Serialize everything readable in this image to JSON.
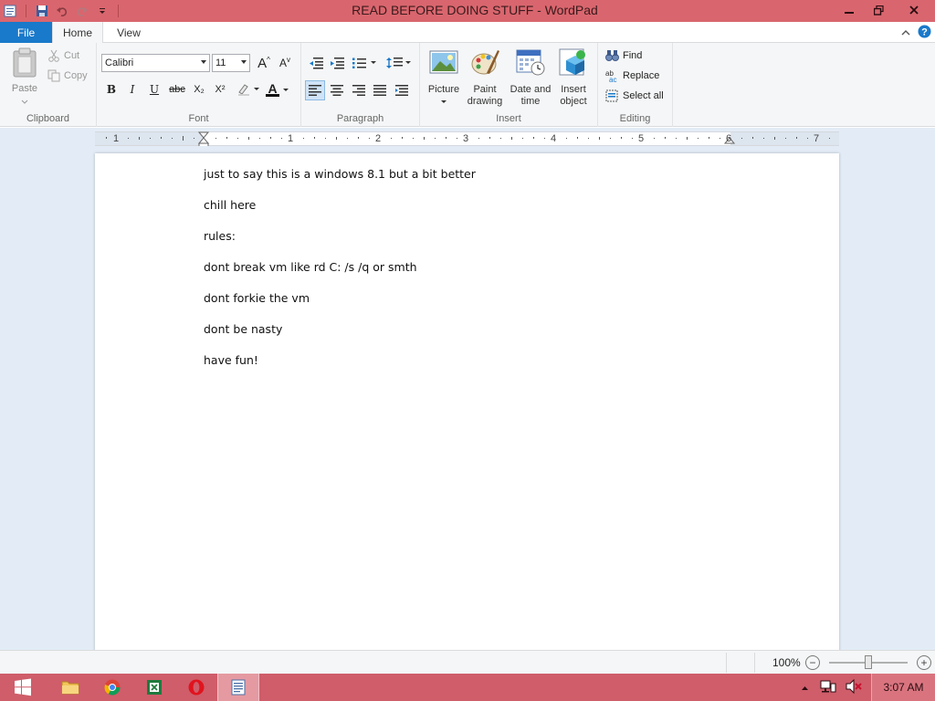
{
  "window": {
    "title": "READ BEFORE DOING STUFF - WordPad",
    "minimize_icon": "minimize-icon",
    "maximize_icon": "restore-icon",
    "close_icon": "close-icon"
  },
  "tabs": {
    "file": "File",
    "home": "Home",
    "view": "View"
  },
  "ribbon": {
    "clipboard": {
      "label": "Clipboard",
      "paste": "Paste",
      "cut": "Cut",
      "copy": "Copy"
    },
    "font": {
      "label": "Font",
      "family": "Calibri",
      "size": "11",
      "bold": "B",
      "italic": "I",
      "underline": "U",
      "strike": "abc",
      "subscript": "X₂",
      "superscript": "X²",
      "grow": "A",
      "shrink": "A",
      "text_color_glyph": "A"
    },
    "paragraph": {
      "label": "Paragraph"
    },
    "insert": {
      "label": "Insert",
      "picture": "Picture",
      "paint_line1": "Paint",
      "paint_line2": "drawing",
      "datetime_line1": "Date and",
      "datetime_line2": "time",
      "object_line1": "Insert",
      "object_line2": "object"
    },
    "editing": {
      "label": "Editing",
      "find": "Find",
      "replace": "Replace",
      "select_all": "Select all"
    }
  },
  "ruler": {
    "numbers": [
      "1",
      "1",
      "2",
      "3",
      "4",
      "5",
      "6",
      "7"
    ]
  },
  "document": {
    "lines": [
      "just to say this is a windows 8.1 but a bit better",
      "chill here",
      "rules:",
      "dont break vm like rd C: /s /q or smth",
      "dont forkie the vm",
      "dont be nasty",
      "have fun!"
    ]
  },
  "statusbar": {
    "zoom": "100%",
    "zoom_out": "−",
    "zoom_in": "+",
    "zoom_level": 1.0
  },
  "taskbar": {
    "clock": "3:07 AM"
  },
  "colors": {
    "titlebar": "#d9666e",
    "file_tab": "#1979ca",
    "taskbar": "#cf5d6a",
    "workspace": "#e3ecf6"
  }
}
